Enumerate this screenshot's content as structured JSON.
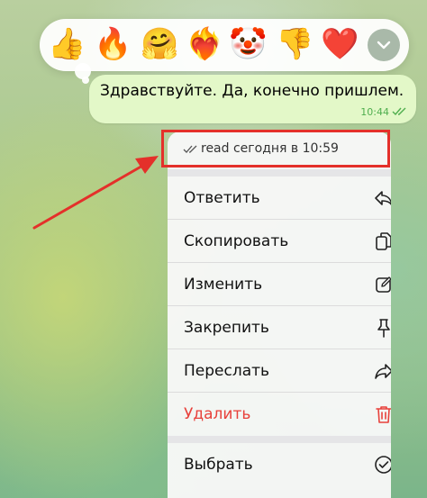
{
  "reactions": [
    {
      "name": "thumbs-up",
      "glyph": "👍"
    },
    {
      "name": "fire",
      "glyph": "🔥"
    },
    {
      "name": "smiling-hug",
      "glyph": "🤗"
    },
    {
      "name": "heart-on-fire",
      "glyph": "❤️‍🔥"
    },
    {
      "name": "clown",
      "glyph": "🤡"
    },
    {
      "name": "thumbs-down",
      "glyph": "👎"
    },
    {
      "name": "red-heart",
      "glyph": "❤️"
    }
  ],
  "message": {
    "text": "Здравствуйте. Да, конечно пришлем.",
    "time": "10:44",
    "status_icon": "double-check-icon"
  },
  "context_menu": {
    "read_status": "read сегодня в 10:59",
    "items": [
      {
        "label": "Ответить",
        "icon": "reply-icon"
      },
      {
        "label": "Скопировать",
        "icon": "copy-icon"
      },
      {
        "label": "Изменить",
        "icon": "edit-icon"
      },
      {
        "label": "Закрепить",
        "icon": "pin-icon"
      },
      {
        "label": "Переслать",
        "icon": "forward-icon"
      },
      {
        "label": "Удалить",
        "icon": "trash-icon",
        "destructive": true
      },
      {
        "label": "Выбрать",
        "icon": "check-circle-icon"
      }
    ]
  },
  "colors": {
    "bubble": "#e3f8c8",
    "accent_green": "#4fae4e",
    "destructive": "#e8413b",
    "annotation": "#e4302a"
  }
}
